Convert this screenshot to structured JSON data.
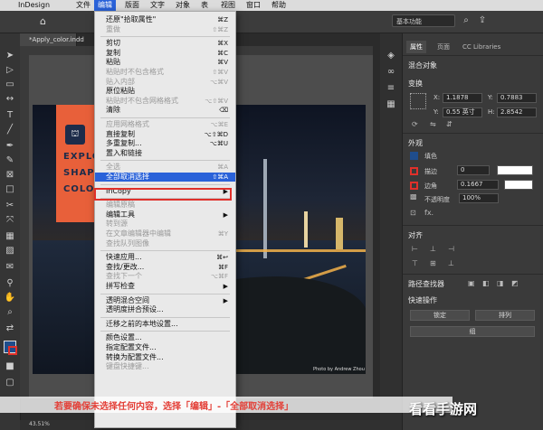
{
  "menubar": {
    "app": "InDesign",
    "items": [
      "文件",
      "编辑",
      "版面",
      "文字",
      "对象",
      "表",
      "视图",
      "窗口",
      "帮助"
    ]
  },
  "appbar": {
    "workspace": "基本功能"
  },
  "document": {
    "tab": "*Apply_color.indd",
    "credit": "Photo by Andrew Zhou"
  },
  "artwork": {
    "lines": [
      "EXPLO",
      "SHAP",
      "COLO"
    ]
  },
  "edit_menu": [
    {
      "label": "还原\"拾取属性\"",
      "shortcut": "⌘Z",
      "state": "normal"
    },
    {
      "label": "重做",
      "shortcut": "⇧⌘Z",
      "state": "disabled"
    },
    {
      "sep": true
    },
    {
      "label": "剪切",
      "shortcut": "⌘X",
      "state": "normal"
    },
    {
      "label": "复制",
      "shortcut": "⌘C",
      "state": "normal"
    },
    {
      "label": "粘贴",
      "shortcut": "⌘V",
      "state": "normal"
    },
    {
      "label": "粘贴时不包含格式",
      "shortcut": "⇧⌘V",
      "state": "disabled"
    },
    {
      "label": "贴入内部",
      "shortcut": "⌥⌘V",
      "state": "disabled"
    },
    {
      "label": "原位粘贴",
      "shortcut": "",
      "state": "normal"
    },
    {
      "label": "粘贴时不包含网格格式",
      "shortcut": "⌥⇧⌘V",
      "state": "disabled"
    },
    {
      "label": "清除",
      "shortcut": "⌫",
      "state": "normal"
    },
    {
      "sep": true
    },
    {
      "label": "应用网格格式",
      "shortcut": "⌥⌘E",
      "state": "disabled"
    },
    {
      "label": "直接复制",
      "shortcut": "⌥⇧⌘D",
      "state": "normal"
    },
    {
      "label": "多重复制...",
      "shortcut": "⌥⌘U",
      "state": "normal"
    },
    {
      "label": "置入和链接",
      "shortcut": "",
      "state": "normal"
    },
    {
      "sep": true
    },
    {
      "label": "全选",
      "shortcut": "⌘A",
      "state": "disabled"
    },
    {
      "label": "全部取消选择",
      "shortcut": "⇧⌘A",
      "state": "highlight"
    },
    {
      "sep": true
    },
    {
      "label": "InCopy",
      "shortcut": "▶",
      "state": "normal"
    },
    {
      "sep": true
    },
    {
      "label": "编辑原稿",
      "shortcut": "",
      "state": "disabled"
    },
    {
      "label": "编辑工具",
      "shortcut": "▶",
      "state": "normal"
    },
    {
      "label": "转到源",
      "shortcut": "",
      "state": "disabled"
    },
    {
      "label": "在文章编辑器中编辑",
      "shortcut": "⌘Y",
      "state": "disabled"
    },
    {
      "label": "查找队列图像",
      "shortcut": "",
      "state": "disabled"
    },
    {
      "sep": true
    },
    {
      "label": "快速应用...",
      "shortcut": "⌘↩",
      "state": "normal"
    },
    {
      "label": "查找/更改...",
      "shortcut": "⌘F",
      "state": "normal"
    },
    {
      "label": "查找下一个",
      "shortcut": "⌥⌘F",
      "state": "disabled"
    },
    {
      "label": "拼写检查",
      "shortcut": "▶",
      "state": "normal"
    },
    {
      "sep": true
    },
    {
      "label": "透明混合空间",
      "shortcut": "▶",
      "state": "normal"
    },
    {
      "label": "透明度拼合预设...",
      "shortcut": "",
      "state": "normal"
    },
    {
      "sep": true
    },
    {
      "label": "迁移之前的本地设置...",
      "shortcut": "",
      "state": "normal"
    },
    {
      "sep": true
    },
    {
      "label": "颜色设置...",
      "shortcut": "",
      "state": "normal"
    },
    {
      "label": "指定配置文件...",
      "shortcut": "",
      "state": "normal"
    },
    {
      "label": "转换为配置文件...",
      "shortcut": "",
      "state": "normal"
    },
    {
      "label": "键盘快捷键...",
      "shortcut": "",
      "state": "disabled"
    }
  ],
  "panel": {
    "tabs": [
      "属性",
      "页面",
      "CC Libraries"
    ],
    "blend": "混合对象",
    "transform": {
      "title": "变换",
      "x_label": "X:",
      "x": "1.1878",
      "y_label": "Y:",
      "y": "0.7883",
      "w_label": "Y:",
      "w": "0.55 英寸",
      "h_label": "H:",
      "h": "2.8542"
    },
    "appearance": {
      "title": "外观",
      "fill": "填色",
      "stroke": "描边",
      "stroke_w": "0",
      "stroke2": "边角",
      "corner": "0.1667",
      "opacity_label": "不透明度",
      "opacity": "100%"
    },
    "align": "对齐",
    "pathfinder": "路径查找器",
    "quick": "快速操作",
    "btn_lock": "锁定",
    "btn_arrange": "排列",
    "btn_group": "组"
  },
  "status": {
    "zoom": "43.51%"
  },
  "caption": "若要确保未选择任何内容，选择「编辑」-「全部取消选择」",
  "watermark": "看看手游网",
  "colors": {
    "highlight": "#2a62d9",
    "accent_red": "#e0302a",
    "orange": "#e8603a"
  }
}
